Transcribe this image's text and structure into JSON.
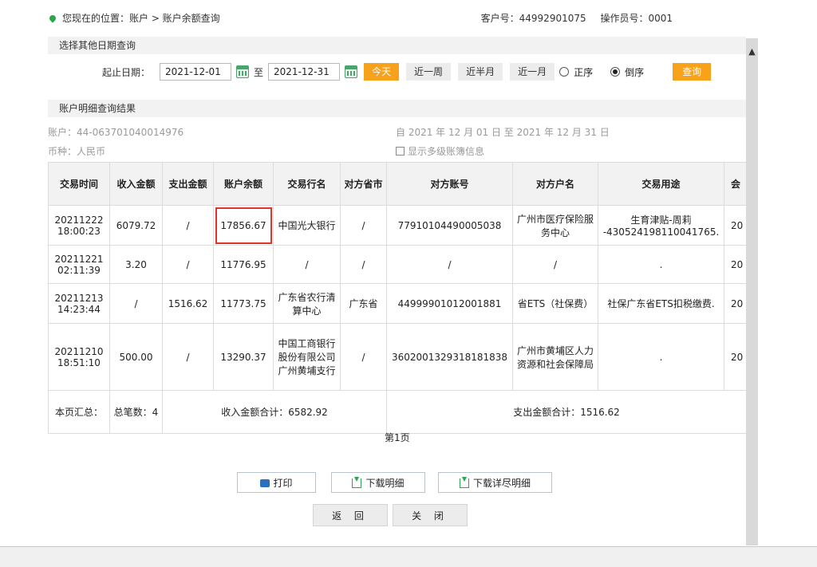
{
  "location": {
    "text": "您现在的位置：账户 > 账户余额查询"
  },
  "customer": {
    "cust_no": "客户号：44992901075",
    "operator": "操作员号：0001"
  },
  "sections": {
    "other_date": "选择其他日期查询",
    "result": "账户明细查询结果"
  },
  "filter": {
    "start_label": "起止日期：",
    "start_date": "2021-12-01",
    "to": "至",
    "end_date": "2021-12-31",
    "today": "今天",
    "week": "近一周",
    "half_month": "近半月",
    "month": "近一月",
    "asc": "正序",
    "desc": "倒序",
    "query": "查询"
  },
  "meta": {
    "account": "账户：44-063701040014976",
    "currency": "币种：人民币",
    "range": "自 2021 年 12 月 01 日 至 2021 年 12 月 31 日",
    "multi": "显示多级账簿信息"
  },
  "table": {
    "headers": [
      "交易时间",
      "收入金额",
      "支出金额",
      "账户余额",
      "交易行名",
      "对方省市",
      "对方账号",
      "对方户名",
      "交易用途",
      "会"
    ],
    "rows": [
      [
        "20211222\n18:00:23",
        "6079.72",
        "/",
        "17856.67",
        "中国光大银行",
        "/",
        "77910104490005038",
        "广州市医疗保险服务中心",
        "生育津贴-周莉\n-430524198110041765.",
        "20"
      ],
      [
        "20211221\n02:11:39",
        "3.20",
        "/",
        "11776.95",
        "/",
        "/",
        "/",
        "/",
        ".",
        "20"
      ],
      [
        "20211213\n14:23:44",
        "/",
        "1516.62",
        "11773.75",
        "广东省农行清算中心",
        "广东省",
        "44999901012001881",
        "省ETS（社保费）",
        "社保广东省ETS扣税缴费.",
        "20"
      ],
      [
        "20211210\n18:51:10",
        "500.00",
        "/",
        "13290.37",
        "中国工商银行股份有限公司广州黄埔支行",
        "/",
        "3602001329318181838",
        "广州市黄埔区人力资源和社会保障局",
        ".",
        "20"
      ]
    ],
    "summary": {
      "label": "本页汇总：",
      "count": "总笔数：4",
      "income": "收入金额合计：6582.92",
      "expense": "支出金额合计：1516.62"
    }
  },
  "page": "第1页",
  "buttons": {
    "print": "打印",
    "download": "下载明细",
    "download_full": "下载详尽明细",
    "back": "返 回",
    "close": "关 闭"
  }
}
